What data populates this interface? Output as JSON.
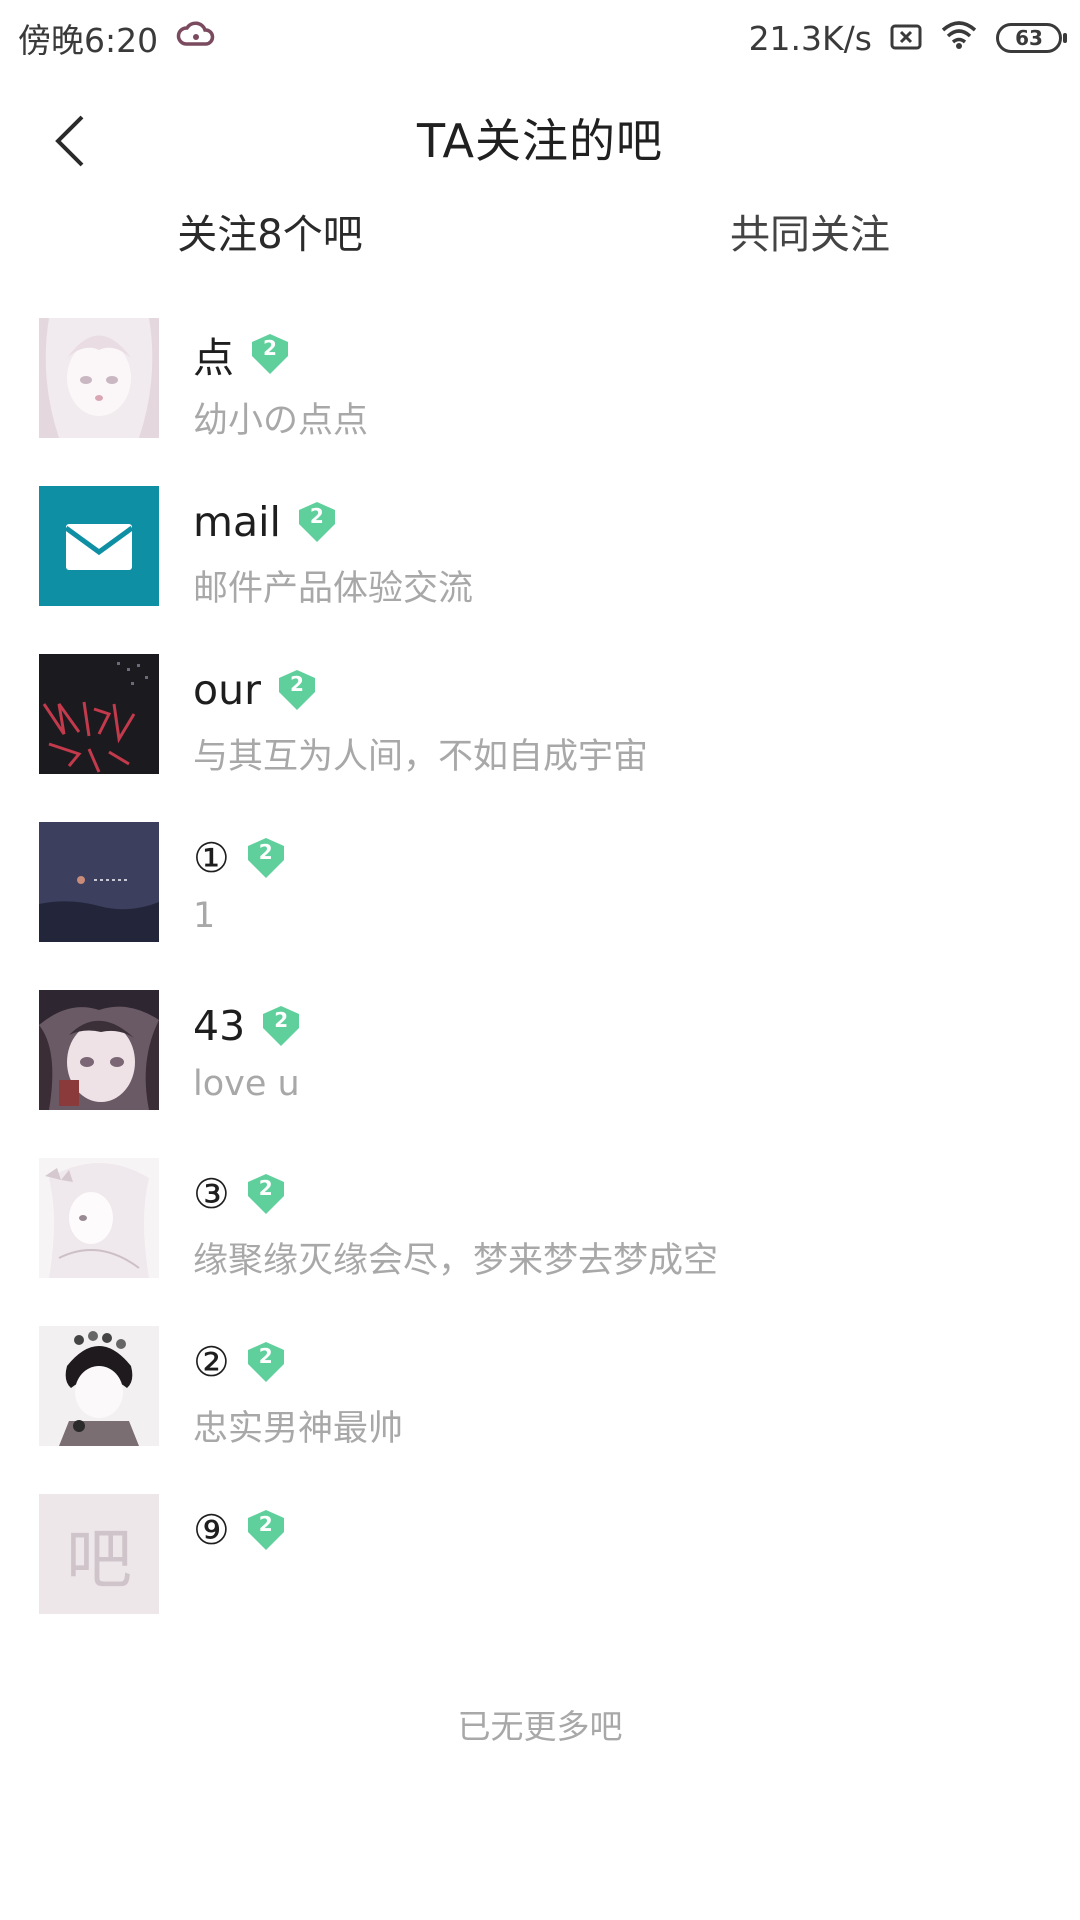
{
  "status_bar": {
    "time": "傍晚6:20",
    "net_speed": "21.3K/s",
    "battery": "63"
  },
  "nav": {
    "title": "TA关注的吧"
  },
  "tabs": [
    {
      "label": "关注8个吧"
    },
    {
      "label": "共同关注"
    }
  ],
  "forums": [
    {
      "name": "点",
      "level": "2",
      "desc": "幼小の点点",
      "avatar": "anime-girl-white"
    },
    {
      "name": "mail",
      "level": "2",
      "desc": "邮件产品体验交流",
      "avatar": "mail-icon"
    },
    {
      "name": "our",
      "level": "2",
      "desc": "与其互为人间，不如自成宇宙",
      "avatar": "dark-remix-art"
    },
    {
      "name": "①",
      "level": "2",
      "desc": "1",
      "avatar": "night-landscape"
    },
    {
      "name": "43",
      "level": "2",
      "desc": "love u",
      "avatar": "anime-girl-dark"
    },
    {
      "name": "③",
      "level": "2",
      "desc": "缘聚缘灭缘会尽，梦来梦去梦成空",
      "avatar": "anime-girl-sketch"
    },
    {
      "name": "②",
      "level": "2",
      "desc": "忠实男神最帅",
      "avatar": "anime-boy-flowers"
    },
    {
      "name": "⑨",
      "level": "2",
      "desc": "",
      "avatar": "default-ba",
      "avatar_text": "吧"
    }
  ],
  "footer": "已无更多吧",
  "colors": {
    "badge": "#5fcf9b",
    "mail_tile": "#0e8fa3",
    "muted_text": "#a8a8a8"
  }
}
